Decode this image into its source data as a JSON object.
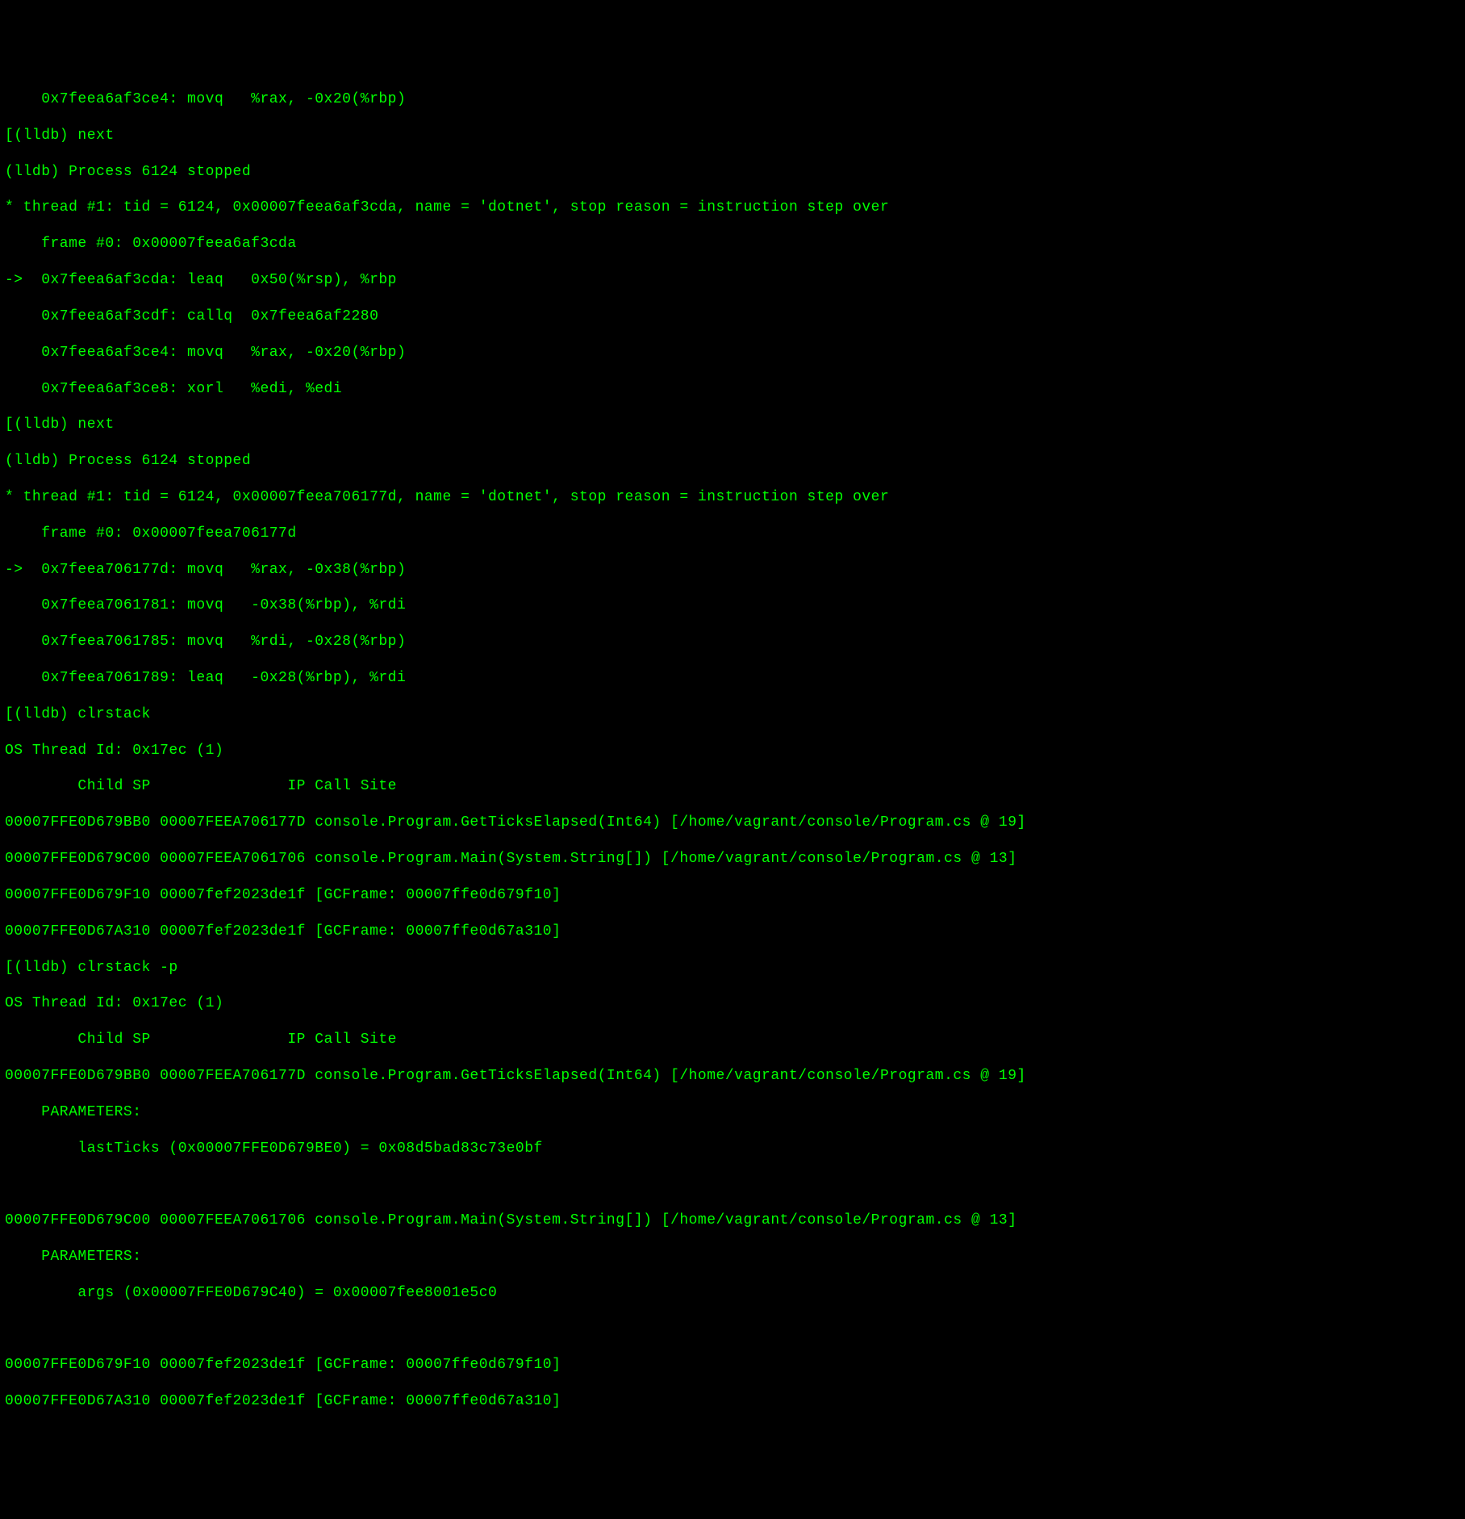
{
  "lines": [
    "    0x7feea6af3ce4: movq   %rax, -0x20(%rbp)",
    "[(lldb) next",
    "(lldb) Process 6124 stopped",
    "* thread #1: tid = 6124, 0x00007feea6af3cda, name = 'dotnet', stop reason = instruction step over",
    "    frame #0: 0x00007feea6af3cda",
    "->  0x7feea6af3cda: leaq   0x50(%rsp), %rbp",
    "    0x7feea6af3cdf: callq  0x7feea6af2280",
    "    0x7feea6af3ce4: movq   %rax, -0x20(%rbp)",
    "    0x7feea6af3ce8: xorl   %edi, %edi",
    "[(lldb) next",
    "(lldb) Process 6124 stopped",
    "* thread #1: tid = 6124, 0x00007feea706177d, name = 'dotnet', stop reason = instruction step over",
    "    frame #0: 0x00007feea706177d",
    "->  0x7feea706177d: movq   %rax, -0x38(%rbp)",
    "    0x7feea7061781: movq   -0x38(%rbp), %rdi",
    "    0x7feea7061785: movq   %rdi, -0x28(%rbp)",
    "    0x7feea7061789: leaq   -0x28(%rbp), %rdi",
    "[(lldb) clrstack",
    "OS Thread Id: 0x17ec (1)",
    "        Child SP               IP Call Site",
    "00007FFE0D679BB0 00007FEEA706177D console.Program.GetTicksElapsed(Int64) [/home/vagrant/console/Program.cs @ 19]",
    "00007FFE0D679C00 00007FEEA7061706 console.Program.Main(System.String[]) [/home/vagrant/console/Program.cs @ 13]",
    "00007FFE0D679F10 00007fef2023de1f [GCFrame: 00007ffe0d679f10]",
    "00007FFE0D67A310 00007fef2023de1f [GCFrame: 00007ffe0d67a310]",
    "[(lldb) clrstack -p",
    "OS Thread Id: 0x17ec (1)",
    "        Child SP               IP Call Site",
    "00007FFE0D679BB0 00007FEEA706177D console.Program.GetTicksElapsed(Int64) [/home/vagrant/console/Program.cs @ 19]",
    "    PARAMETERS:",
    "        lastTicks (0x00007FFE0D679BE0) = 0x08d5bad83c73e0bf",
    "",
    "00007FFE0D679C00 00007FEEA7061706 console.Program.Main(System.String[]) [/home/vagrant/console/Program.cs @ 13]",
    "    PARAMETERS:",
    "        args (0x00007FFE0D679C40) = 0x00007fee8001e5c0",
    "",
    "00007FFE0D679F10 00007fef2023de1f [GCFrame: 00007ffe0d679f10]",
    "00007FFE0D67A310 00007fef2023de1f [GCFrame: 00007ffe0d67a310]"
  ]
}
